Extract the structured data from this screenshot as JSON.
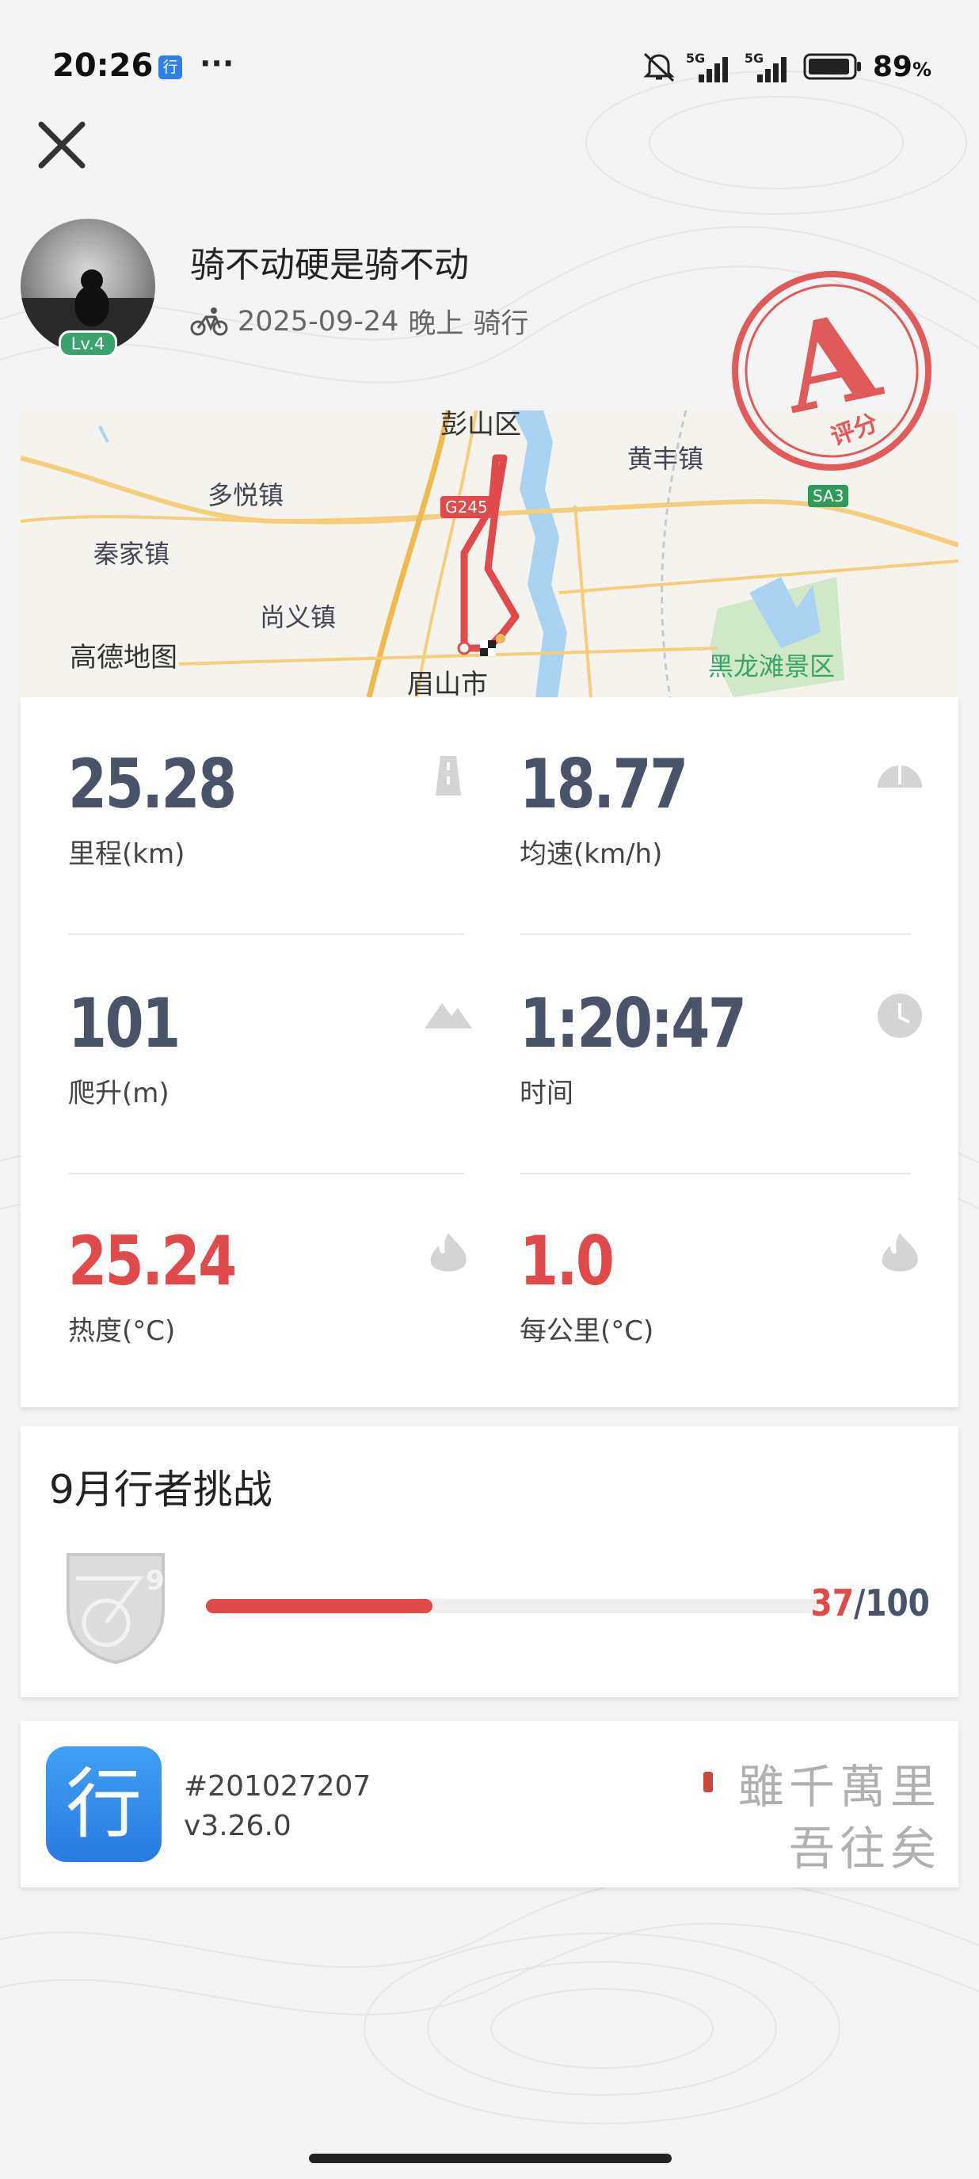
{
  "status_bar": {
    "time": "20:26",
    "app_icon_char": "行",
    "more": "···",
    "signal_1": "5G",
    "signal_2": "5G",
    "battery_percent": "89",
    "battery_unit": "%"
  },
  "header": {
    "close_icon": "close-icon"
  },
  "profile": {
    "username": "骑不动硬是骑不动",
    "level": "Lv.4",
    "date": "2025-09-24",
    "time_of_day": "晚上",
    "activity_type": "骑行"
  },
  "grade": {
    "letter": "A",
    "label": "评分"
  },
  "map": {
    "labels": {
      "pengshan": "彭山区",
      "huangfeng": "黄丰镇",
      "duoyue": "多悦镇",
      "qinjia": "秦家镇",
      "shangyi": "尚义镇",
      "amap": "高德地图",
      "meishan": "眉山市",
      "heilongtan": "黑龙滩景区"
    },
    "road_g245": "G245",
    "road_sa3": "SA3"
  },
  "stats": [
    {
      "value": "25.28",
      "label": "里程(km)",
      "icon": "road-icon",
      "highlight": false
    },
    {
      "value": "18.77",
      "label": "均速(km/h)",
      "icon": "speedometer-icon",
      "highlight": false
    },
    {
      "value": "101",
      "label": "爬升(m)",
      "icon": "mountain-icon",
      "highlight": false
    },
    {
      "value": "1:20:47",
      "label": "时间",
      "icon": "clock-icon",
      "highlight": false
    },
    {
      "value": "25.24",
      "label": "热度(°C)",
      "icon": "flame-icon",
      "highlight": true
    },
    {
      "value": "1.0",
      "label": "每公里(°C)",
      "icon": "flame-icon",
      "highlight": true
    }
  ],
  "challenge": {
    "title": "9月行者挑战",
    "current": "37",
    "total": "100",
    "progress_fraction": 0.37,
    "badge_number": "9"
  },
  "app_info": {
    "logo_char": "行",
    "id": "#201027207",
    "version": "v3.26.0",
    "calligraphy_line1": "雖千萬里",
    "calligraphy_line2": "吾往矣"
  },
  "colors": {
    "accent_red": "#e04a4a",
    "stat_gray": "#4a5468",
    "level_green": "#3aa36b",
    "app_blue": "#2f7fe6"
  }
}
